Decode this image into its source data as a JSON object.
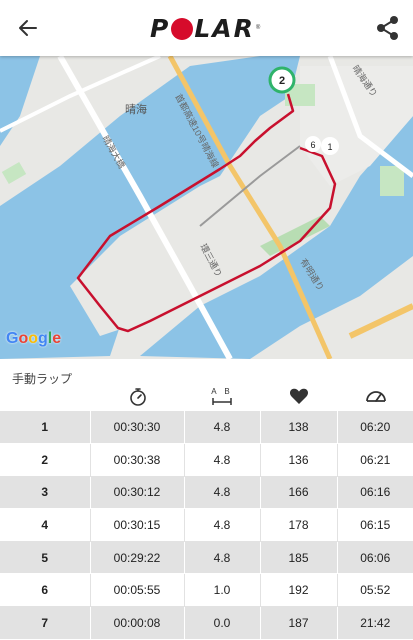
{
  "header": {
    "back_icon": "arrow-left-icon",
    "logo_text": "POLAR",
    "share_icon": "share-icon"
  },
  "map": {
    "labels": {
      "harumi": "晴海",
      "expressway": "首都高速10号晴海線",
      "harumi_dori": "晴海通り",
      "bridge": "晴海大橋",
      "ring3": "環三通り",
      "ariake_dori": "有明通り"
    },
    "markers": [
      "2",
      "6",
      "1"
    ],
    "attribution": "Google",
    "route_color": "#c8102e"
  },
  "laps": {
    "title": "手動ラップ",
    "column_icons": [
      "stopwatch-icon",
      "distance-icon",
      "heart-icon",
      "pace-gauge-icon"
    ],
    "distance_icon_label": "A B",
    "rows": [
      {
        "lap": "1",
        "time": "00:30:30",
        "distance": "4.8",
        "hr": "138",
        "pace": "06:20"
      },
      {
        "lap": "2",
        "time": "00:30:38",
        "distance": "4.8",
        "hr": "136",
        "pace": "06:21"
      },
      {
        "lap": "3",
        "time": "00:30:12",
        "distance": "4.8",
        "hr": "166",
        "pace": "06:16"
      },
      {
        "lap": "4",
        "time": "00:30:15",
        "distance": "4.8",
        "hr": "178",
        "pace": "06:15"
      },
      {
        "lap": "5",
        "time": "00:29:22",
        "distance": "4.8",
        "hr": "185",
        "pace": "06:06"
      },
      {
        "lap": "6",
        "time": "00:05:55",
        "distance": "1.0",
        "hr": "192",
        "pace": "05:52"
      },
      {
        "lap": "7",
        "time": "00:00:08",
        "distance": "0.0",
        "hr": "187",
        "pace": "21:42"
      }
    ]
  }
}
